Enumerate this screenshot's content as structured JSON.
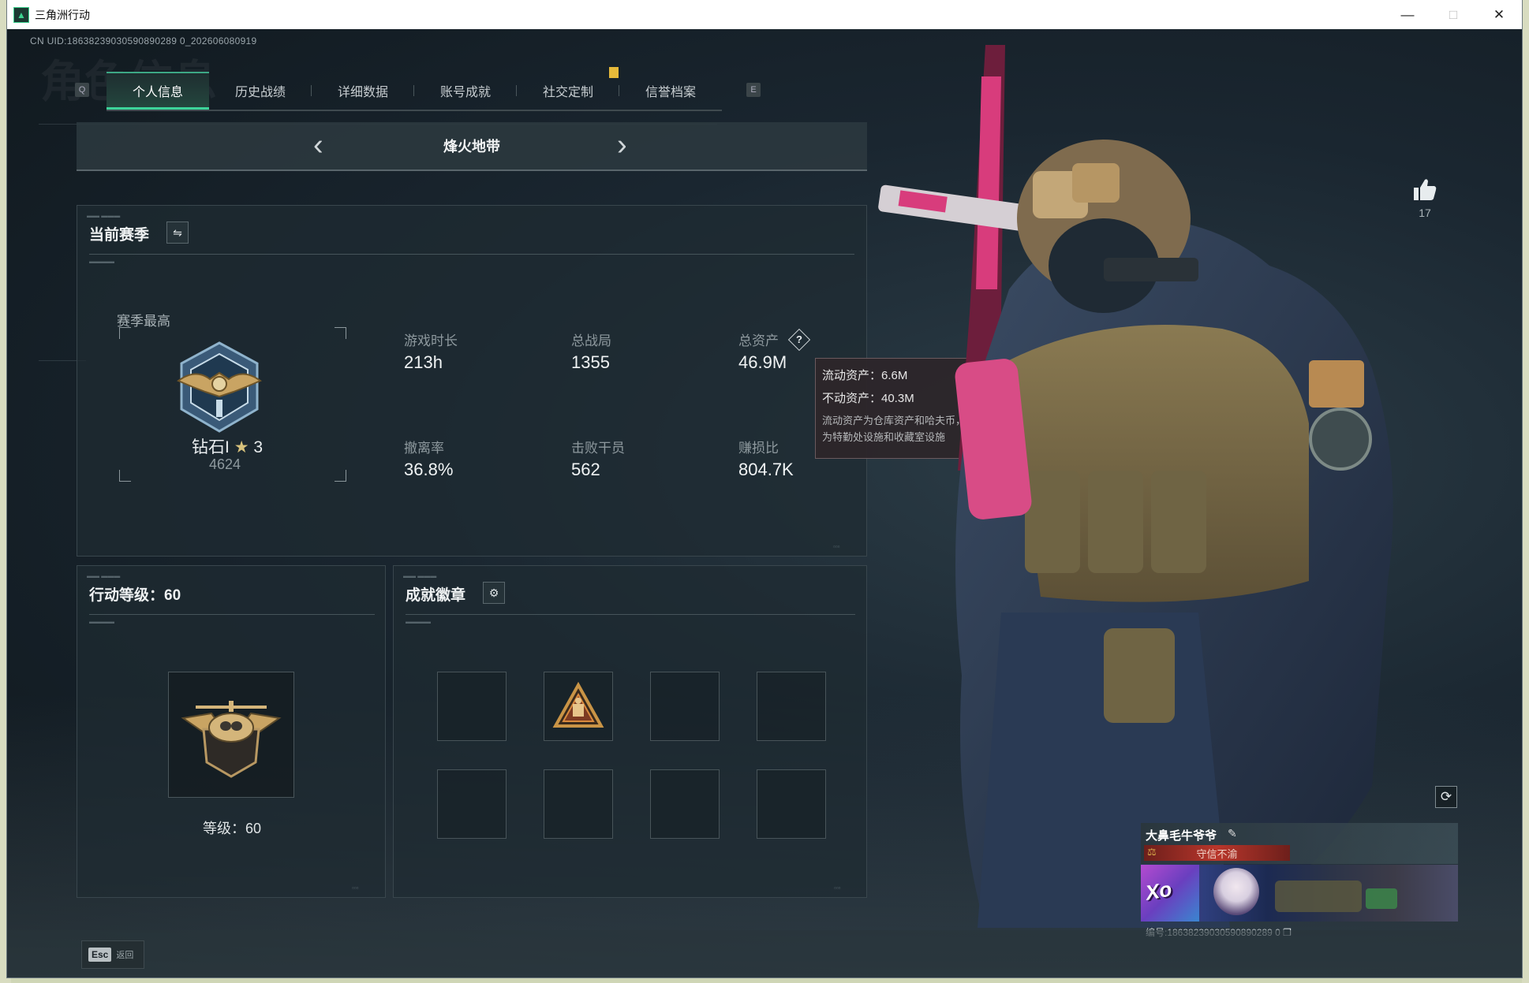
{
  "window": {
    "title": "三角洲行动",
    "controls": [
      "—",
      "□",
      "✕"
    ]
  },
  "uid_line": "CN UID:18638239030590890289 0_202606080919",
  "nav": {
    "left_key": "Q",
    "right_key": "E",
    "tabs": [
      {
        "label": "个人信息",
        "active": true
      },
      {
        "label": "历史战绩",
        "active": false
      },
      {
        "label": "详细数据",
        "active": false
      },
      {
        "label": "账号成就",
        "active": false
      },
      {
        "label": "社交定制",
        "active": false
      },
      {
        "label": "信誉档案",
        "active": false
      }
    ]
  },
  "mode": {
    "title": "烽火地带",
    "prev": "‹",
    "next": "›"
  },
  "season": {
    "header": "当前赛季",
    "switch_icon": "⇋",
    "best_label": "赛季最高",
    "rank_name": "钻石I",
    "rank_star": "★",
    "rank_stars": "3",
    "rank_score": "4624",
    "stats": [
      {
        "label": "游戏时长",
        "value": "213h"
      },
      {
        "label": "总战局",
        "value": "1355"
      },
      {
        "label": "总资产",
        "value": "46.9M"
      },
      {
        "label": "撤离率",
        "value": "36.8%"
      },
      {
        "label": "击败干员",
        "value": "562"
      },
      {
        "label": "赚损比",
        "value": "804.7K"
      }
    ],
    "help_icon": "?"
  },
  "tooltip": {
    "liquid": "流动资产：6.6M",
    "fixed": "不动资产：40.3M",
    "note_line1": "流动资产为仓库资产和哈夫币，不动资产",
    "note_line2": "为特勤处设施和收藏室设施"
  },
  "level": {
    "header": "行动等级：60",
    "level_text": "等级：60"
  },
  "badges": {
    "header": "成就徽章",
    "gear_icon": "⚙",
    "slots": 8,
    "filled_index": 1
  },
  "bottom": {
    "esc_key": "Esc",
    "esc_label": "返回"
  },
  "likes": {
    "icon": "thumbs-up-icon",
    "count": "17"
  },
  "player_card": {
    "name": "大鼻毛牛爷爷",
    "edit_icon": "✎",
    "title": "守信不渝",
    "id_line": "编号:18638239030590890289 0",
    "copy_icon": "❐",
    "refresh_icon": "⟳"
  },
  "colors": {
    "accent": "#3dd39a",
    "panel_bg": "#1f2b32",
    "title_badge": "#b8362b",
    "alert": "#e6b93a"
  }
}
